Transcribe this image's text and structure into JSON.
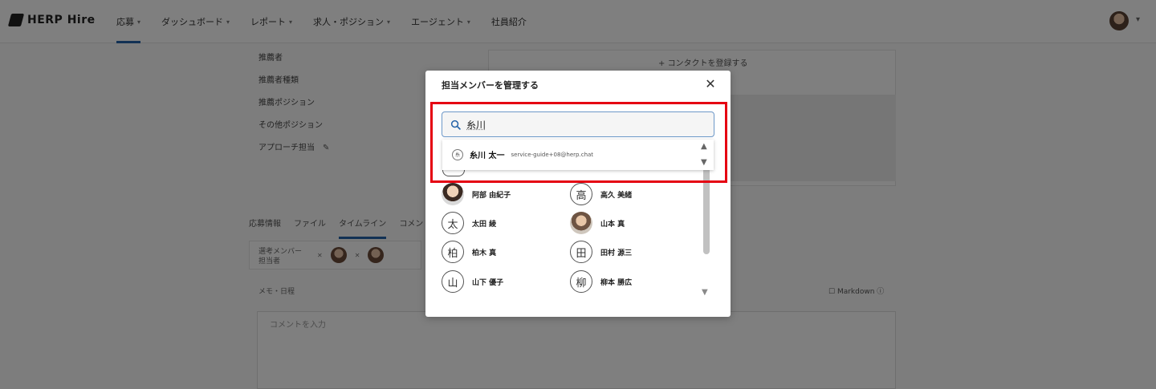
{
  "app": {
    "logo_text": "HERP Hire",
    "nav": [
      {
        "label": "応募"
      },
      {
        "label": "ダッシュボード"
      },
      {
        "label": "レポート"
      },
      {
        "label": "求人・ポジション"
      },
      {
        "label": "エージェント"
      },
      {
        "label": "社員紹介"
      }
    ],
    "side": {
      "items": [
        "推薦者",
        "推薦者種類",
        "推薦ポジション",
        "その他ポジション",
        "アプローチ担当"
      ]
    },
    "contact_button": "コンタクトを登録する",
    "tabs": [
      "応募情報",
      "ファイル",
      "タイムライン",
      "コメント"
    ],
    "member_row_label": "選考メンバー\n担当者",
    "memo_label": "メモ・日程",
    "markdown_label": "Markdown",
    "comment_placeholder": "コメントを入力"
  },
  "modal": {
    "title": "担当メンバーを管理する",
    "close_icon": "close-icon",
    "search": {
      "value": "糸川",
      "icon": "search-icon"
    },
    "suggestion": {
      "avatar_char": "糸",
      "name": "糸川 太一",
      "email": "service-guide+08@herp.chat"
    },
    "members": [
      {
        "name": "阿部 由紀子",
        "avatar": "photo"
      },
      {
        "name": "高久 美緒",
        "avatar": "高"
      },
      {
        "name": "太田 綾",
        "avatar": "太"
      },
      {
        "name": "山本 真",
        "avatar": "photo"
      },
      {
        "name": "柏木 真",
        "avatar": "柏"
      },
      {
        "name": "田村 源三",
        "avatar": "田"
      },
      {
        "name": "山下 優子",
        "avatar": "山"
      },
      {
        "name": "柳本 勝広",
        "avatar": "柳"
      }
    ]
  },
  "colors": {
    "highlight": "#e50012",
    "accent": "#2563a8"
  }
}
